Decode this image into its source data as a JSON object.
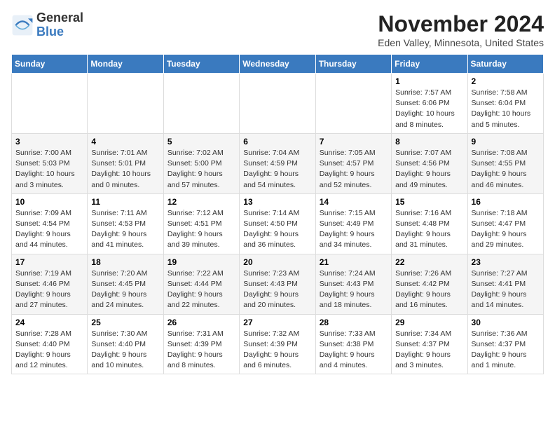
{
  "header": {
    "logo_line1": "General",
    "logo_line2": "Blue",
    "month": "November 2024",
    "location": "Eden Valley, Minnesota, United States"
  },
  "weekdays": [
    "Sunday",
    "Monday",
    "Tuesday",
    "Wednesday",
    "Thursday",
    "Friday",
    "Saturday"
  ],
  "weeks": [
    [
      {
        "day": "",
        "info": ""
      },
      {
        "day": "",
        "info": ""
      },
      {
        "day": "",
        "info": ""
      },
      {
        "day": "",
        "info": ""
      },
      {
        "day": "",
        "info": ""
      },
      {
        "day": "1",
        "info": "Sunrise: 7:57 AM\nSunset: 6:06 PM\nDaylight: 10 hours\nand 8 minutes."
      },
      {
        "day": "2",
        "info": "Sunrise: 7:58 AM\nSunset: 6:04 PM\nDaylight: 10 hours\nand 5 minutes."
      }
    ],
    [
      {
        "day": "3",
        "info": "Sunrise: 7:00 AM\nSunset: 5:03 PM\nDaylight: 10 hours\nand 3 minutes."
      },
      {
        "day": "4",
        "info": "Sunrise: 7:01 AM\nSunset: 5:01 PM\nDaylight: 10 hours\nand 0 minutes."
      },
      {
        "day": "5",
        "info": "Sunrise: 7:02 AM\nSunset: 5:00 PM\nDaylight: 9 hours\nand 57 minutes."
      },
      {
        "day": "6",
        "info": "Sunrise: 7:04 AM\nSunset: 4:59 PM\nDaylight: 9 hours\nand 54 minutes."
      },
      {
        "day": "7",
        "info": "Sunrise: 7:05 AM\nSunset: 4:57 PM\nDaylight: 9 hours\nand 52 minutes."
      },
      {
        "day": "8",
        "info": "Sunrise: 7:07 AM\nSunset: 4:56 PM\nDaylight: 9 hours\nand 49 minutes."
      },
      {
        "day": "9",
        "info": "Sunrise: 7:08 AM\nSunset: 4:55 PM\nDaylight: 9 hours\nand 46 minutes."
      }
    ],
    [
      {
        "day": "10",
        "info": "Sunrise: 7:09 AM\nSunset: 4:54 PM\nDaylight: 9 hours\nand 44 minutes."
      },
      {
        "day": "11",
        "info": "Sunrise: 7:11 AM\nSunset: 4:53 PM\nDaylight: 9 hours\nand 41 minutes."
      },
      {
        "day": "12",
        "info": "Sunrise: 7:12 AM\nSunset: 4:51 PM\nDaylight: 9 hours\nand 39 minutes."
      },
      {
        "day": "13",
        "info": "Sunrise: 7:14 AM\nSunset: 4:50 PM\nDaylight: 9 hours\nand 36 minutes."
      },
      {
        "day": "14",
        "info": "Sunrise: 7:15 AM\nSunset: 4:49 PM\nDaylight: 9 hours\nand 34 minutes."
      },
      {
        "day": "15",
        "info": "Sunrise: 7:16 AM\nSunset: 4:48 PM\nDaylight: 9 hours\nand 31 minutes."
      },
      {
        "day": "16",
        "info": "Sunrise: 7:18 AM\nSunset: 4:47 PM\nDaylight: 9 hours\nand 29 minutes."
      }
    ],
    [
      {
        "day": "17",
        "info": "Sunrise: 7:19 AM\nSunset: 4:46 PM\nDaylight: 9 hours\nand 27 minutes."
      },
      {
        "day": "18",
        "info": "Sunrise: 7:20 AM\nSunset: 4:45 PM\nDaylight: 9 hours\nand 24 minutes."
      },
      {
        "day": "19",
        "info": "Sunrise: 7:22 AM\nSunset: 4:44 PM\nDaylight: 9 hours\nand 22 minutes."
      },
      {
        "day": "20",
        "info": "Sunrise: 7:23 AM\nSunset: 4:43 PM\nDaylight: 9 hours\nand 20 minutes."
      },
      {
        "day": "21",
        "info": "Sunrise: 7:24 AM\nSunset: 4:43 PM\nDaylight: 9 hours\nand 18 minutes."
      },
      {
        "day": "22",
        "info": "Sunrise: 7:26 AM\nSunset: 4:42 PM\nDaylight: 9 hours\nand 16 minutes."
      },
      {
        "day": "23",
        "info": "Sunrise: 7:27 AM\nSunset: 4:41 PM\nDaylight: 9 hours\nand 14 minutes."
      }
    ],
    [
      {
        "day": "24",
        "info": "Sunrise: 7:28 AM\nSunset: 4:40 PM\nDaylight: 9 hours\nand 12 minutes."
      },
      {
        "day": "25",
        "info": "Sunrise: 7:30 AM\nSunset: 4:40 PM\nDaylight: 9 hours\nand 10 minutes."
      },
      {
        "day": "26",
        "info": "Sunrise: 7:31 AM\nSunset: 4:39 PM\nDaylight: 9 hours\nand 8 minutes."
      },
      {
        "day": "27",
        "info": "Sunrise: 7:32 AM\nSunset: 4:39 PM\nDaylight: 9 hours\nand 6 minutes."
      },
      {
        "day": "28",
        "info": "Sunrise: 7:33 AM\nSunset: 4:38 PM\nDaylight: 9 hours\nand 4 minutes."
      },
      {
        "day": "29",
        "info": "Sunrise: 7:34 AM\nSunset: 4:37 PM\nDaylight: 9 hours\nand 3 minutes."
      },
      {
        "day": "30",
        "info": "Sunrise: 7:36 AM\nSunset: 4:37 PM\nDaylight: 9 hours\nand 1 minute."
      }
    ]
  ]
}
